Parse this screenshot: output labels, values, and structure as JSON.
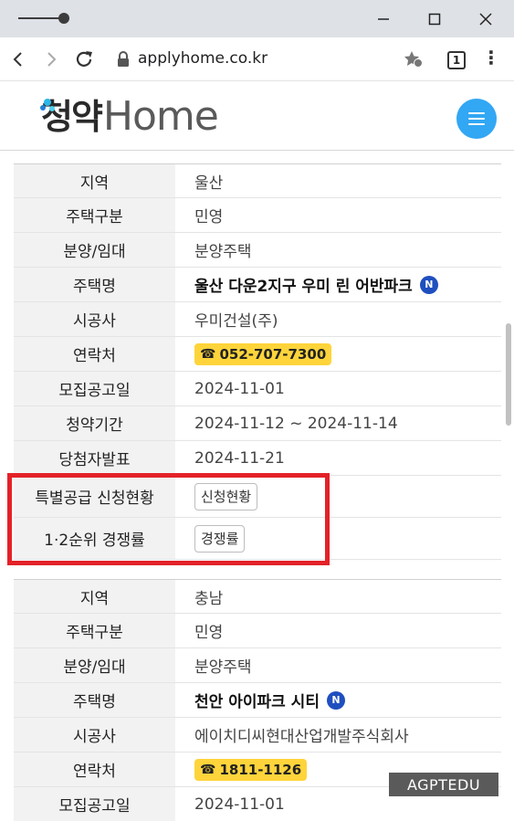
{
  "browser": {
    "url": "applyhome.co.kr",
    "tab_count": "1"
  },
  "site": {
    "logo_korean": "청약",
    "logo_english": "Home"
  },
  "listing1": {
    "rows": [
      {
        "label": "지역",
        "value": "울산"
      },
      {
        "label": "주택구분",
        "value": "민영"
      },
      {
        "label": "분양/임대",
        "value": "분양주택"
      },
      {
        "label": "주택명",
        "value": "울산 다운2지구 우미 린 어반파크",
        "badge": "N"
      },
      {
        "label": "시공사",
        "value": "우미건설(주)"
      },
      {
        "label": "연락처",
        "value": "052-707-7300"
      },
      {
        "label": "모집공고일",
        "value": "2024-11-01"
      },
      {
        "label": "청약기간",
        "value": "2024-11-12 ~ 2024-11-14"
      },
      {
        "label": "당첨자발표",
        "value": "2024-11-21"
      },
      {
        "label": "특별공급 신청현황",
        "button": "신청현황"
      },
      {
        "label": "1·2순위 경쟁률",
        "button": "경쟁률"
      }
    ]
  },
  "listing2": {
    "rows": [
      {
        "label": "지역",
        "value": "충남"
      },
      {
        "label": "주택구분",
        "value": "민영"
      },
      {
        "label": "분양/임대",
        "value": "분양주택"
      },
      {
        "label": "주택명",
        "value": "천안 아이파크 시티",
        "badge": "N"
      },
      {
        "label": "시공사",
        "value": "에이치디씨현대산업개발주식회사"
      },
      {
        "label": "연락처",
        "value": "1811-1126"
      },
      {
        "label": "모집공고일",
        "value": "2024-11-01"
      }
    ]
  },
  "watermark": "AGPTEDU",
  "colors": {
    "accent_blue": "#32a7f3",
    "phone_yellow": "#ffd43b",
    "highlight_red": "#e32228",
    "badge_blue": "#1f4fbf"
  }
}
